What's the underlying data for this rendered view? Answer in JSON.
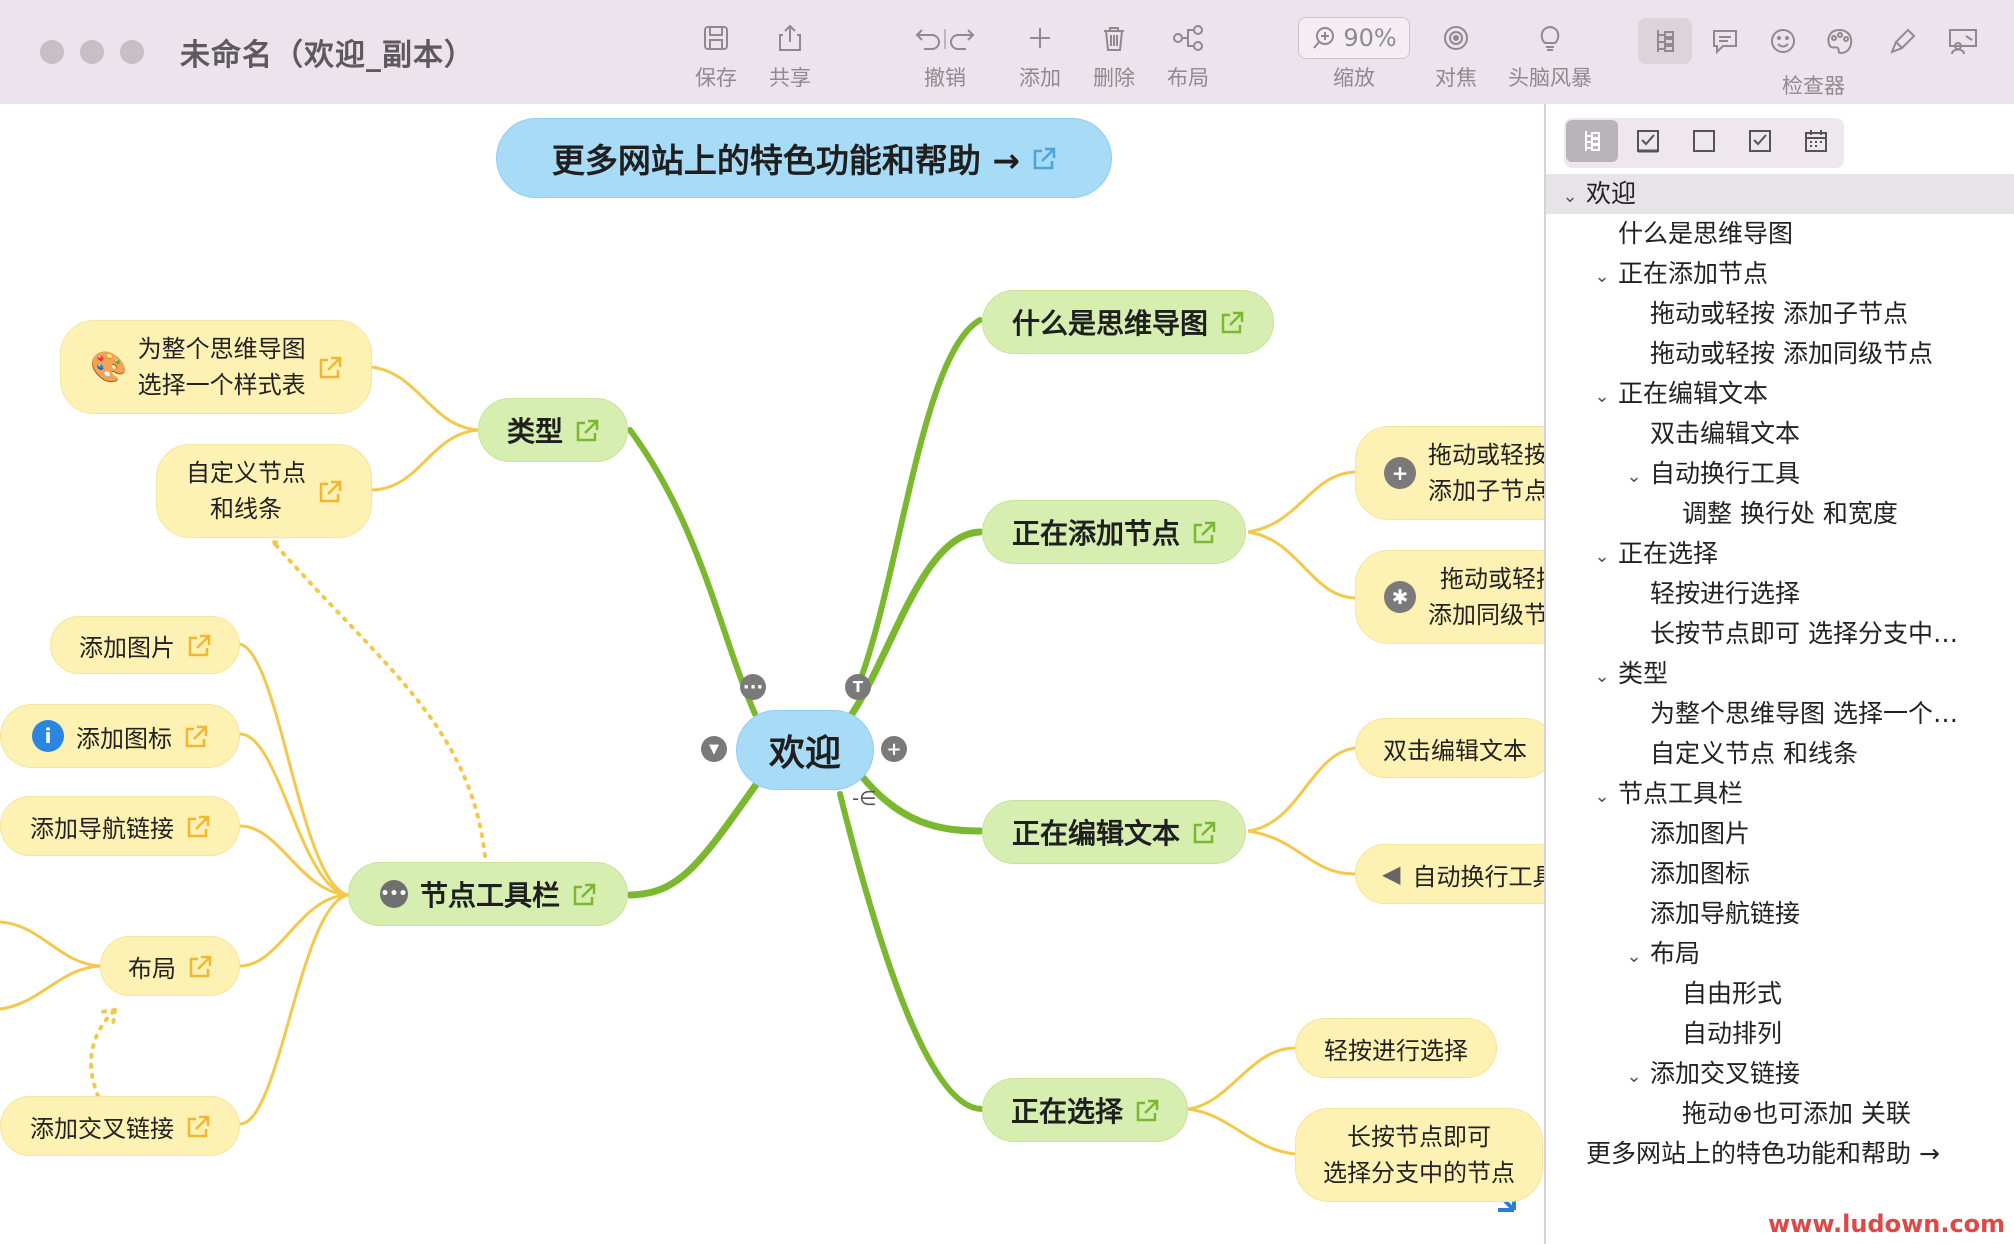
{
  "window": {
    "title": "未命名（欢迎_副本）"
  },
  "toolbar": {
    "save": "保存",
    "share": "共享",
    "undo": "撤销",
    "add": "添加",
    "delete": "删除",
    "layout": "布局",
    "zoom_value": "90%",
    "zoom": "缩放",
    "focus": "对焦",
    "brainstorm": "头脑风暴",
    "inspector": "检查器"
  },
  "canvas": {
    "banner": "更多网站上的特色功能和帮助 →",
    "root": "欢迎",
    "main": {
      "what_is": "什么是思维导图",
      "adding": "正在添加节点",
      "editing": "正在编辑文本",
      "selecting": "正在选择",
      "types": "类型",
      "toolbar": "节点工具栏"
    },
    "sub": {
      "drag_child_1": "拖动或轻按",
      "drag_child_2": "添加子节点",
      "drag_sib_1": "拖动或轻按",
      "drag_sib_2": "添加同级节点",
      "dbl_edit": "双击编辑文本",
      "auto_wrap": "自动换行工具",
      "tap_select": "轻按进行选择",
      "long_press_1": "长按节点即可",
      "long_press_2": "选择分支中的节点",
      "style_1": "为整个思维导图",
      "style_2": "选择一个样式表",
      "custom_1": "自定义节点",
      "custom_2": "和线条",
      "add_image": "添加图片",
      "add_icon": "添加图标",
      "add_nav": "添加导航链接",
      "layout": "布局",
      "add_cross": "添加交叉链接"
    }
  },
  "outline": [
    {
      "text": "欢迎",
      "level": 0,
      "expanded": true
    },
    {
      "text": "什么是思维导图",
      "level": 1,
      "expanded": null
    },
    {
      "text": "正在添加节点",
      "level": 1,
      "expanded": true
    },
    {
      "text": "拖动或轻按 添加子节点",
      "level": 2,
      "expanded": null
    },
    {
      "text": "拖动或轻按 添加同级节点",
      "level": 2,
      "expanded": null
    },
    {
      "text": "正在编辑文本",
      "level": 1,
      "expanded": true
    },
    {
      "text": "双击编辑文本",
      "level": 2,
      "expanded": null
    },
    {
      "text": "自动换行工具",
      "level": 2,
      "expanded": true
    },
    {
      "text": "调整 换行处 和宽度",
      "level": 3,
      "expanded": null
    },
    {
      "text": "正在选择",
      "level": 1,
      "expanded": true
    },
    {
      "text": "轻按进行选择",
      "level": 2,
      "expanded": null
    },
    {
      "text": "长按节点即可 选择分支中…",
      "level": 2,
      "expanded": null
    },
    {
      "text": "类型",
      "level": 1,
      "expanded": true
    },
    {
      "text": "为整个思维导图 选择一个…",
      "level": 2,
      "expanded": null
    },
    {
      "text": "自定义节点 和线条",
      "level": 2,
      "expanded": null
    },
    {
      "text": "节点工具栏",
      "level": 1,
      "expanded": true
    },
    {
      "text": "添加图片",
      "level": 2,
      "expanded": null
    },
    {
      "text": "添加图标",
      "level": 2,
      "expanded": null
    },
    {
      "text": "添加导航链接",
      "level": 2,
      "expanded": null
    },
    {
      "text": "布局",
      "level": 2,
      "expanded": true
    },
    {
      "text": "自由形式",
      "level": 3,
      "expanded": null
    },
    {
      "text": "自动排列",
      "level": 3,
      "expanded": null
    },
    {
      "text": "添加交叉链接",
      "level": 2,
      "expanded": true
    },
    {
      "text": "拖动⊕也可添加 关联",
      "level": 3,
      "expanded": null
    },
    {
      "text": "更多网站上的特色功能和帮助 →",
      "level": 0,
      "expanded": null
    }
  ],
  "watermark": "www.ludown.com",
  "colors": {
    "main_branch": "#7cb82f",
    "sub_branch": "#f2c94c",
    "root_fill": "#a8dcf6",
    "main_fill": "#d6efb0",
    "sub_fill": "#fdf2b3",
    "toolbar_bg": "#ece3ec"
  }
}
